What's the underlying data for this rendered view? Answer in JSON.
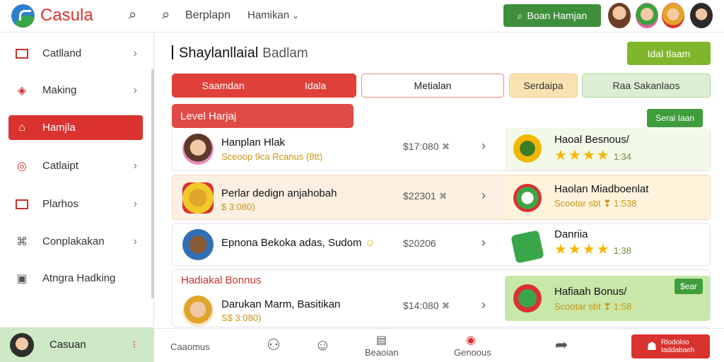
{
  "app": {
    "name": "Casula"
  },
  "topbar": {
    "link1": "Berplapn",
    "dropdown": "Hamikan",
    "cta": "Boan Hamjan",
    "icons": [
      "search-icon",
      "search-icon",
      "chevron-down-icon"
    ]
  },
  "sidebar": {
    "items": [
      {
        "label": "Catlland",
        "icon": "square-icon"
      },
      {
        "label": "Making",
        "icon": "diamond-icon"
      },
      {
        "label": "Hamjla",
        "icon": "home-icon",
        "active": true
      },
      {
        "label": "Catlaipt",
        "icon": "target-icon"
      },
      {
        "label": "Plarhos",
        "icon": "briefcase-icon"
      },
      {
        "label": "Conplakakan",
        "icon": "link-icon"
      },
      {
        "label": "Atngra Hadking",
        "icon": "box-icon"
      }
    ],
    "user": {
      "name": "Casuan",
      "menu": "⁝"
    }
  },
  "main": {
    "title": "Shaylanllaial",
    "subtitle": "Badlam",
    "cta": "Idal tlaam",
    "tabs": [
      {
        "label": "Saamdan",
        "label2": "Idala"
      },
      {
        "label": "Metialan"
      },
      {
        "label": "Serdaipa"
      },
      {
        "label": "Raa Sakanlaos"
      }
    ],
    "section_title": "Level Harjaj",
    "section2_title": "Hadiakal Bonnus",
    "rows": [
      {
        "name": "Hanplan Hlak",
        "sub": "Sceoop  9ca  Rcanus (8tt)",
        "price": "$17:080",
        "right_title": "Haoal Besnous/",
        "right_rating": "1:34",
        "right_chip": "Seral Iaan"
      },
      {
        "name": "Perlar dedign anjahobah",
        "sub": "$ 3:080)",
        "price": "$22301",
        "right_title": "Haolan Miadboenlat",
        "right_sub": "Scootar sbt  ❣ 1:538"
      },
      {
        "name": "Epnona Bekoka adas, Sudom",
        "price": "$20206",
        "right_title": "Danriia",
        "right_rating": "1:38"
      },
      {
        "name": "Darukan Marm, Basitikan",
        "sub": "S$ 3:080)",
        "price": "$14:080",
        "right_title": "Hafiaah Bonus/",
        "right_sub": "Scootar sbt  ❣ 1:58",
        "right_chip": "$ear"
      }
    ]
  },
  "bottom": {
    "item1": "Caaomus",
    "item2": "Beaoian",
    "item3": "Genoous",
    "cta_line1": "Rlodoloo",
    "cta_line2": "Iaddabaeh"
  },
  "colors": {
    "brand_red": "#d9322f",
    "brand_green": "#3e8f3a",
    "accent_lime": "#7fb62b"
  }
}
